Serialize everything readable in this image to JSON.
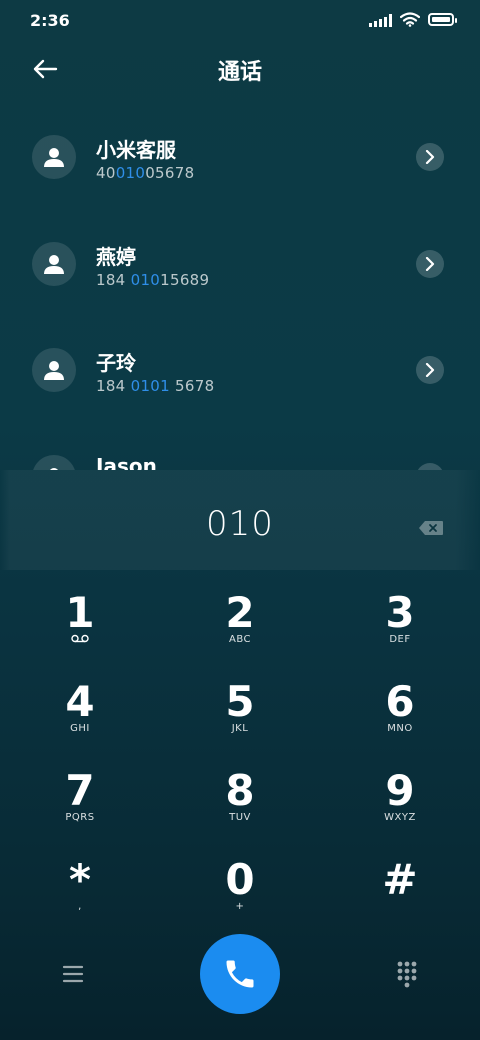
{
  "status_bar": {
    "time": "2:36"
  },
  "header": {
    "title": "通话"
  },
  "contacts": [
    {
      "name": "小米客服",
      "number_pre": "40",
      "number_hl": "010",
      "number_post": "05678"
    },
    {
      "name": "燕婷",
      "number_pre": "184 ",
      "number_hl": "010",
      "number_post": "15689"
    },
    {
      "name": "子玲",
      "number_pre": "184 ",
      "number_hl": "0101",
      "number_post": " 5678"
    },
    {
      "name": "Jason",
      "number_pre": "",
      "number_hl": "",
      "number_post": ""
    }
  ],
  "dialer": {
    "digits": "010"
  },
  "keypad": [
    {
      "num": "1",
      "sub": ""
    },
    {
      "num": "2",
      "sub": "ABC"
    },
    {
      "num": "3",
      "sub": "DEF"
    },
    {
      "num": "4",
      "sub": "GHI"
    },
    {
      "num": "5",
      "sub": "JKL"
    },
    {
      "num": "6",
      "sub": "MNO"
    },
    {
      "num": "7",
      "sub": "PQRS"
    },
    {
      "num": "8",
      "sub": "TUV"
    },
    {
      "num": "9",
      "sub": "WXYZ"
    },
    {
      "num": "*",
      "sub": ","
    },
    {
      "num": "0",
      "sub": "+"
    },
    {
      "num": "#",
      "sub": ""
    }
  ],
  "colors": {
    "accent": "#1b8cf0",
    "highlight": "#2f8ee8"
  },
  "icons": {
    "back": "arrow-left-icon",
    "avatar": "person-icon",
    "detail": "chevron-right-icon",
    "backspace": "backspace-icon",
    "voicemail": "voicemail-icon",
    "menu": "menu-icon",
    "call": "phone-icon",
    "dialpad": "dialpad-icon"
  }
}
